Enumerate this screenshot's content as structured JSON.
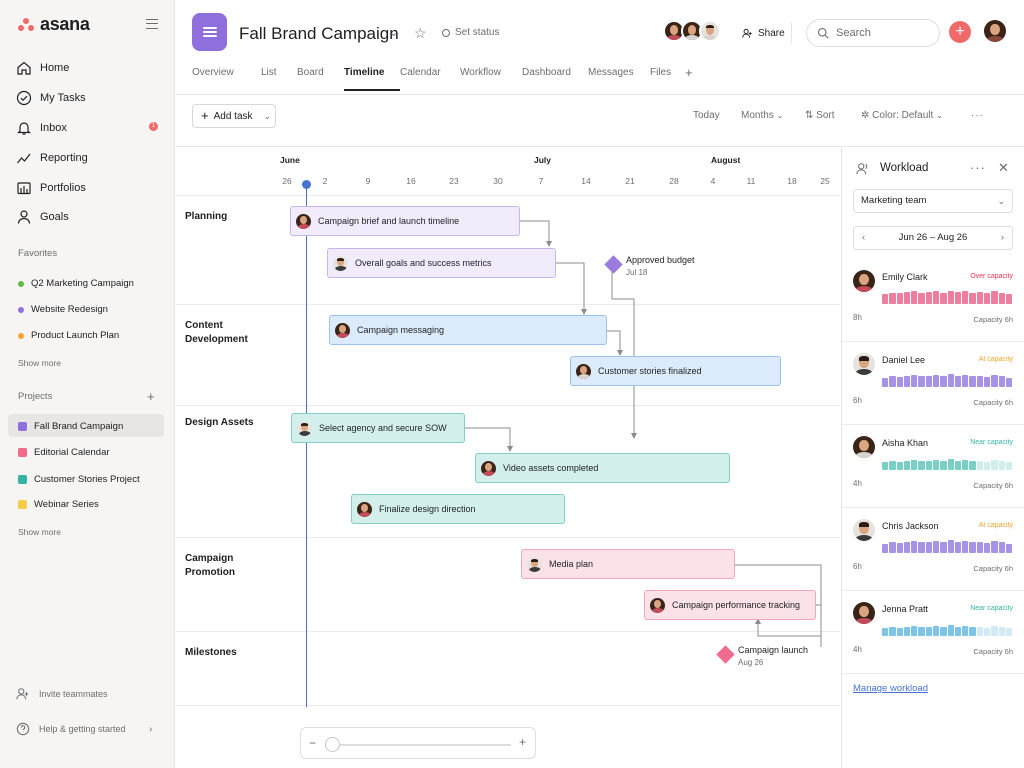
{
  "app": {
    "logo": "asana"
  },
  "colors": {
    "accent": "#f06a6a",
    "project": "#8f6fdb",
    "today": "#4573d2",
    "link": "#4573d2"
  },
  "sidebar": {
    "nav": [
      {
        "label": "Home",
        "icon": "home-icon"
      },
      {
        "label": "My Tasks",
        "icon": "check-circle-icon"
      },
      {
        "label": "Inbox",
        "icon": "bell-icon",
        "badge": "1"
      },
      {
        "label": "Reporting",
        "icon": "chart-line-icon"
      },
      {
        "label": "Portfolios",
        "icon": "folder-icon"
      },
      {
        "label": "Goals",
        "icon": "person-icon"
      }
    ],
    "favorites_label": "Favorites",
    "favorites": [
      {
        "label": "Q2 Marketing Campaign",
        "color": "#62b847"
      },
      {
        "label": "Website Redesign",
        "color": "#8f6fdb"
      },
      {
        "label": "Product Launch Plan",
        "color": "#f1a52c"
      }
    ],
    "favorites_more": "Show more",
    "projects_label": "Projects",
    "projects": [
      {
        "label": "Fall Brand Campaign",
        "color": "#8f6fdb"
      },
      {
        "label": "Editorial Calendar",
        "color": "#f06a8a"
      },
      {
        "label": "Customer Stories Project",
        "color": "#37b3a6"
      },
      {
        "label": "Webinar Series",
        "color": "#f5cd47"
      }
    ],
    "projects_more": "Show more",
    "invite": "Invite teammates",
    "help": "Help & getting started"
  },
  "header": {
    "title": "Fall Brand Campaign",
    "set_status": "Set status",
    "share": "Share",
    "search_placeholder": "Search",
    "tabs": [
      "Overview",
      "List",
      "Board",
      "Timeline",
      "Calendar",
      "Workflow",
      "Dashboard",
      "Messages",
      "Files"
    ],
    "active_tab": "Timeline",
    "tab_add": "+"
  },
  "toolbar": {
    "add_task": "Add task",
    "today": "Today",
    "months": "Months",
    "sort": "Sort",
    "color": "Color: Default",
    "more": "···"
  },
  "timeline": {
    "months": [
      "June",
      "July",
      "August"
    ],
    "days": [
      "26",
      "2",
      "9",
      "16",
      "23",
      "30",
      "7",
      "14",
      "21",
      "28",
      "4",
      "11",
      "18",
      "25"
    ],
    "sections": [
      "Planning",
      "Content Development",
      "Design Assets",
      "Campaign Promotion",
      "Milestones"
    ],
    "tasks": [
      {
        "label": "Campaign brief and launch timeline",
        "color": "purple"
      },
      {
        "label": "Overall goals and success metrics",
        "color": "purple"
      },
      {
        "label": "Campaign messaging",
        "color": "blue"
      },
      {
        "label": "Customer stories finalized",
        "color": "blue"
      },
      {
        "label": "Select agency and secure SOW",
        "color": "teal"
      },
      {
        "label": "Video assets completed",
        "color": "teal"
      },
      {
        "label": "Finalize design direction",
        "color": "teal"
      },
      {
        "label": "Media plan",
        "color": "pink"
      },
      {
        "label": "Campaign performance tracking",
        "color": "pink"
      }
    ],
    "milestones": [
      {
        "label": "Approved budget",
        "date": "Jul 18",
        "color": "#9b7be0"
      },
      {
        "label": "Campaign launch",
        "date": "Aug 26",
        "color": "#ee6d8e"
      }
    ]
  },
  "workload": {
    "title": "Workload",
    "team": "Marketing team",
    "range": "Jun 26 – Aug 26",
    "manage": "Manage workload",
    "people": [
      {
        "name": "Emily Clark",
        "status": "Over capacity",
        "status_color": "#e8384f",
        "hours": "8h",
        "capacity": "Capacity 6h",
        "bar_color": "#ec7fa0",
        "load": 1.0
      },
      {
        "name": "Daniel Lee",
        "status": "At capacity",
        "status_color": "#f1a52c",
        "hours": "6h",
        "capacity": "Capacity 6h",
        "bar_color": "#a693e6",
        "load": 0.9
      },
      {
        "name": "Aisha Khan",
        "status": "Near capacity",
        "status_color": "#37b3a6",
        "hours": "4h",
        "capacity": "Capacity 6h",
        "bar_color": "#79cfc6",
        "load": 0.55
      },
      {
        "name": "Chris Jackson",
        "status": "At capacity",
        "status_color": "#f1a52c",
        "hours": "6h",
        "capacity": "Capacity 6h",
        "bar_color": "#a693e6",
        "load": 0.9
      },
      {
        "name": "Jenna Pratt",
        "status": "Near capacity",
        "status_color": "#37b3a6",
        "hours": "4h",
        "capacity": "Capacity 6h",
        "bar_color": "#7ec4e6",
        "load": 0.55
      }
    ]
  }
}
